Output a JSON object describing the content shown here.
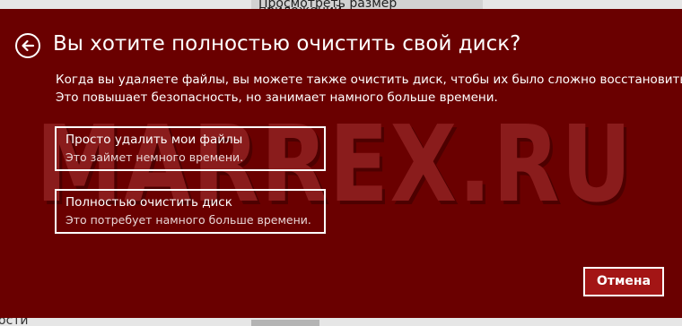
{
  "background": {
    "top_text": "Просмотреть размер приложений",
    "bottom_text": "ости"
  },
  "watermark": "MARREX.RU",
  "dialog": {
    "title": "Вы хотите полностью очистить свой диск?",
    "description": [
      "Когда вы удаляете файлы, вы можете также очистить диск, чтобы их было сложно восстановить.",
      "Это повышает безопасность, но занимает намного больше времени."
    ],
    "options": [
      {
        "title": "Просто удалить мои файлы",
        "subtitle": "Это займет немного времени."
      },
      {
        "title": "Полностью очистить диск",
        "subtitle": "Это потребует намного больше времени."
      }
    ],
    "cancel_label": "Отмена"
  },
  "colors": {
    "dialog_background": "#6a0000",
    "cancel_button": "#a31515",
    "text": "#ffffff"
  },
  "icons": {
    "back": "back-arrow-icon"
  }
}
